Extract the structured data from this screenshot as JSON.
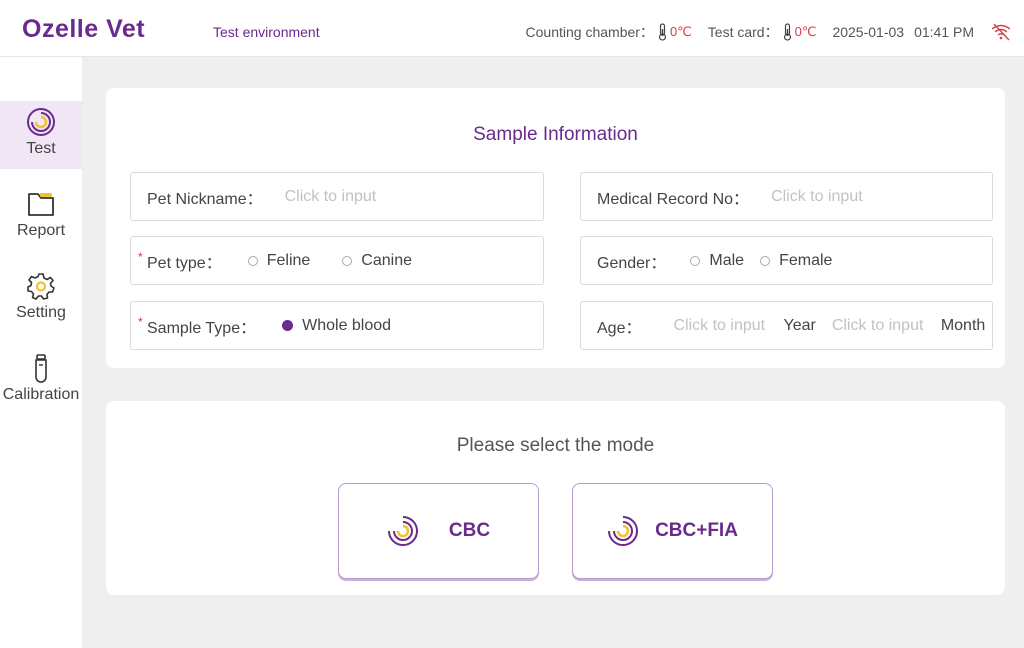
{
  "header": {
    "logo": "Ozelle Vet",
    "environment": "Test environment",
    "counting_chamber_label": "Counting chamber：",
    "counting_chamber_temp": "0℃",
    "test_card_label": "Test card：",
    "test_card_temp": "0℃",
    "date": "2025-01-03",
    "time": "01:41 PM",
    "wifi_icon": "wifi-off-icon"
  },
  "sidebar": {
    "items": [
      {
        "label": "Test",
        "icon": "test-ring-icon",
        "active": true
      },
      {
        "label": "Report",
        "icon": "folder-icon",
        "active": false
      },
      {
        "label": "Setting",
        "icon": "gear-icon",
        "active": false
      },
      {
        "label": "Calibration",
        "icon": "vial-icon",
        "active": false
      }
    ]
  },
  "sample_info": {
    "title": "Sample Information",
    "pet_nickname": {
      "label": "Pet Nickname：",
      "placeholder": "Click to input",
      "value": ""
    },
    "medical_record": {
      "label": "Medical Record No：",
      "placeholder": "Click to input",
      "value": ""
    },
    "pet_type": {
      "label": "Pet type：",
      "required": "*",
      "options": [
        "Feline",
        "Canine"
      ],
      "selected": null
    },
    "gender": {
      "label": "Gender：",
      "options": [
        "Male",
        "Female"
      ],
      "selected": null
    },
    "sample_type": {
      "label": "Sample Type：",
      "required": "*",
      "options": [
        "Whole blood"
      ],
      "selected": "Whole blood"
    },
    "age": {
      "label": "Age：",
      "year_placeholder": "Click to input",
      "year_unit": "Year",
      "month_placeholder": "Click to input",
      "month_unit": "Month"
    }
  },
  "mode": {
    "title": "Please select the mode",
    "buttons": [
      {
        "label": "CBC",
        "icon": "cbc-ring-icon"
      },
      {
        "label": "CBC+FIA",
        "icon": "cbc-fia-ring-icon"
      }
    ]
  },
  "colors": {
    "brand": "#6a2a8e",
    "accent_yellow": "#f2c230",
    "temp_red": "#e0393e",
    "background": "#efefef"
  }
}
